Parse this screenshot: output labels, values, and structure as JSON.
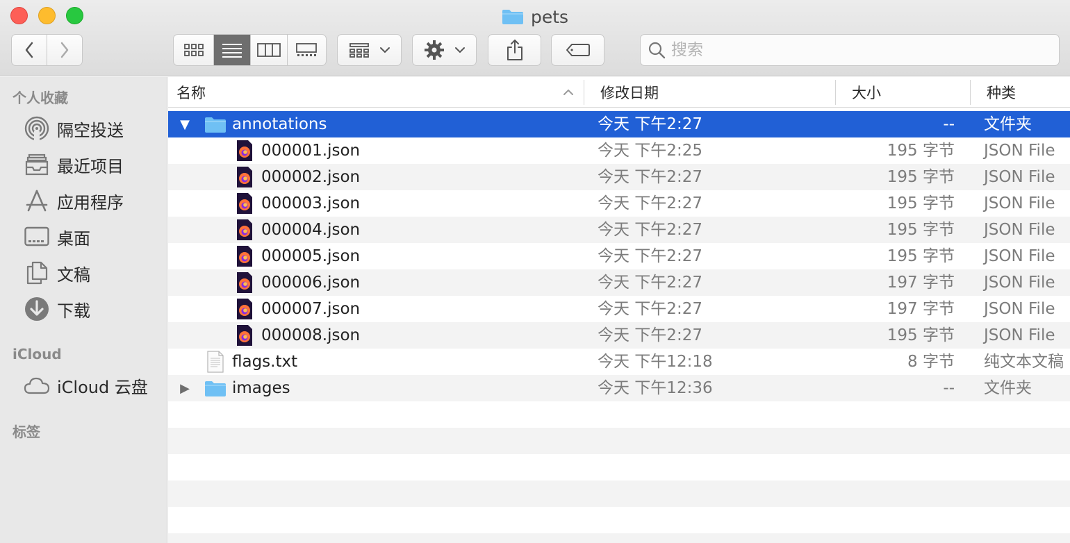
{
  "window": {
    "title": "pets"
  },
  "toolbar": {
    "search_placeholder": "搜索"
  },
  "sidebar": {
    "favorites_header": "个人收藏",
    "favorites": [
      {
        "label": "隔空投送",
        "icon": "airdrop-icon"
      },
      {
        "label": "最近项目",
        "icon": "recents-icon"
      },
      {
        "label": "应用程序",
        "icon": "applications-icon"
      },
      {
        "label": "桌面",
        "icon": "desktop-icon"
      },
      {
        "label": "文稿",
        "icon": "documents-icon"
      },
      {
        "label": "下载",
        "icon": "downloads-icon"
      }
    ],
    "icloud_header": "iCloud",
    "icloud_items": [
      {
        "label": "iCloud 云盘",
        "icon": "icloud-icon"
      }
    ],
    "tags_header": "标签"
  },
  "columns": {
    "name": "名称",
    "date": "修改日期",
    "size": "大小",
    "kind": "种类"
  },
  "rows": [
    {
      "name": "annotations",
      "date": "今天 下午2:27",
      "size": "--",
      "kind": "文件夹",
      "type": "folder",
      "expanded": true
    },
    {
      "name": "000001.json",
      "date": "今天 下午2:25",
      "size": "195 字节",
      "kind": "JSON File",
      "type": "json"
    },
    {
      "name": "000002.json",
      "date": "今天 下午2:27",
      "size": "195 字节",
      "kind": "JSON File",
      "type": "json"
    },
    {
      "name": "000003.json",
      "date": "今天 下午2:27",
      "size": "195 字节",
      "kind": "JSON File",
      "type": "json"
    },
    {
      "name": "000004.json",
      "date": "今天 下午2:27",
      "size": "195 字节",
      "kind": "JSON File",
      "type": "json"
    },
    {
      "name": "000005.json",
      "date": "今天 下午2:27",
      "size": "195 字节",
      "kind": "JSON File",
      "type": "json"
    },
    {
      "name": "000006.json",
      "date": "今天 下午2:27",
      "size": "197 字节",
      "kind": "JSON File",
      "type": "json"
    },
    {
      "name": "000007.json",
      "date": "今天 下午2:27",
      "size": "197 字节",
      "kind": "JSON File",
      "type": "json"
    },
    {
      "name": "000008.json",
      "date": "今天 下午2:27",
      "size": "195 字节",
      "kind": "JSON File",
      "type": "json"
    },
    {
      "name": "flags.txt",
      "date": "今天 下午12:18",
      "size": "8 字节",
      "kind": "纯文本文稿",
      "type": "text"
    },
    {
      "name": "images",
      "date": "今天 下午12:36",
      "size": "--",
      "kind": "文件夹",
      "type": "folder",
      "expanded": false
    }
  ],
  "colors": {
    "selection": "#2160d6",
    "folder": "#6fc0f4",
    "close": "#fd5f57",
    "minimize": "#febc2e",
    "maximize": "#28c840"
  }
}
